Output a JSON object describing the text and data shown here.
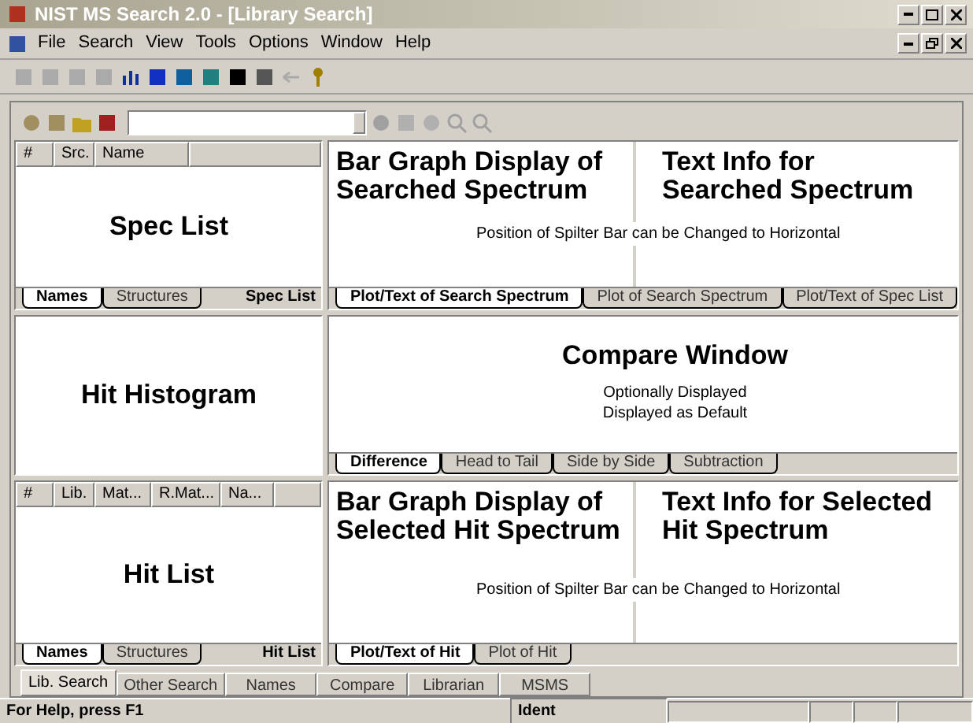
{
  "window": {
    "title": "NIST MS Search 2.0 - [Library Search]"
  },
  "menu": [
    "File",
    "Search",
    "View",
    "Tools",
    "Options",
    "Window",
    "Help"
  ],
  "spec_list": {
    "columns": [
      "#",
      "Src.",
      "Name"
    ],
    "label": "Spec List",
    "tabs": [
      {
        "label": "Names",
        "selected": true
      },
      {
        "label": "Structures",
        "selected": false
      }
    ],
    "caption": "Spec List"
  },
  "search_plot": {
    "left_label": "Bar Graph Display of Searched Spectrum",
    "right_label": "Text Info for Searched Spectrum",
    "note": "Position of Spilter Bar can be Changed to Horizontal",
    "tabs": [
      {
        "label": "Plot/Text of Search Spectrum",
        "selected": true
      },
      {
        "label": "Plot of Search Spectrum",
        "selected": false
      },
      {
        "label": "Plot/Text of Spec List",
        "selected": false
      }
    ]
  },
  "hit_histogram": {
    "label": "Hit Histogram"
  },
  "compare": {
    "title": "Compare Window",
    "lines": [
      "Optionally Displayed",
      "Displayed as Default"
    ],
    "tabs": [
      {
        "label": "Difference",
        "selected": true
      },
      {
        "label": "Head to Tail",
        "selected": false
      },
      {
        "label": "Side by Side",
        "selected": false
      },
      {
        "label": "Subtraction",
        "selected": false
      }
    ]
  },
  "hit_list": {
    "columns": [
      "#",
      "Lib.",
      "Mat...",
      "R.Mat...",
      "Na..."
    ],
    "label": "Hit List",
    "tabs": [
      {
        "label": "Names",
        "selected": true
      },
      {
        "label": "Structures",
        "selected": false
      }
    ],
    "caption": "Hit List"
  },
  "hit_plot": {
    "left_label": "Bar Graph Display of Selected Hit Spectrum",
    "right_label": "Text Info for Selected Hit Spectrum",
    "note": "Position of Spilter Bar can be Changed to Horizontal",
    "tabs": [
      {
        "label": "Plot/Text of Hit",
        "selected": true
      },
      {
        "label": "Plot of Hit",
        "selected": false
      }
    ]
  },
  "bottom_tabs": [
    {
      "label": "Lib. Search",
      "selected": true
    },
    {
      "label": "Other Search",
      "selected": false
    },
    {
      "label": "Names",
      "selected": false
    },
    {
      "label": "Compare",
      "selected": false
    },
    {
      "label": "Librarian",
      "selected": false
    },
    {
      "label": "MSMS",
      "selected": false
    }
  ],
  "status_bar": {
    "help": "For Help, press F1",
    "mode": "Ident"
  }
}
